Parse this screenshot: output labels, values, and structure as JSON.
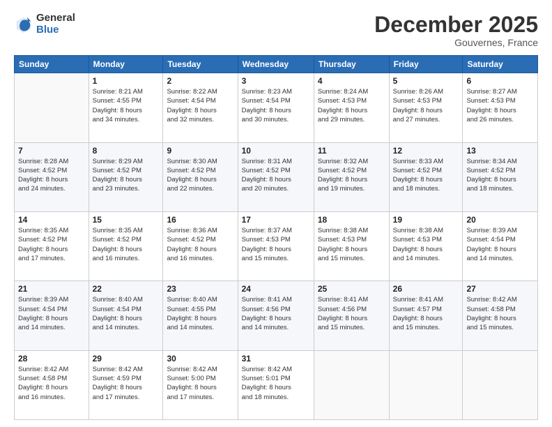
{
  "logo": {
    "general": "General",
    "blue": "Blue"
  },
  "header": {
    "month_year": "December 2025",
    "location": "Gouvernes, France"
  },
  "weekdays": [
    "Sunday",
    "Monday",
    "Tuesday",
    "Wednesday",
    "Thursday",
    "Friday",
    "Saturday"
  ],
  "weeks": [
    [
      {
        "day": "",
        "info": ""
      },
      {
        "day": "1",
        "info": "Sunrise: 8:21 AM\nSunset: 4:55 PM\nDaylight: 8 hours\nand 34 minutes."
      },
      {
        "day": "2",
        "info": "Sunrise: 8:22 AM\nSunset: 4:54 PM\nDaylight: 8 hours\nand 32 minutes."
      },
      {
        "day": "3",
        "info": "Sunrise: 8:23 AM\nSunset: 4:54 PM\nDaylight: 8 hours\nand 30 minutes."
      },
      {
        "day": "4",
        "info": "Sunrise: 8:24 AM\nSunset: 4:53 PM\nDaylight: 8 hours\nand 29 minutes."
      },
      {
        "day": "5",
        "info": "Sunrise: 8:26 AM\nSunset: 4:53 PM\nDaylight: 8 hours\nand 27 minutes."
      },
      {
        "day": "6",
        "info": "Sunrise: 8:27 AM\nSunset: 4:53 PM\nDaylight: 8 hours\nand 26 minutes."
      }
    ],
    [
      {
        "day": "7",
        "info": "Sunrise: 8:28 AM\nSunset: 4:52 PM\nDaylight: 8 hours\nand 24 minutes."
      },
      {
        "day": "8",
        "info": "Sunrise: 8:29 AM\nSunset: 4:52 PM\nDaylight: 8 hours\nand 23 minutes."
      },
      {
        "day": "9",
        "info": "Sunrise: 8:30 AM\nSunset: 4:52 PM\nDaylight: 8 hours\nand 22 minutes."
      },
      {
        "day": "10",
        "info": "Sunrise: 8:31 AM\nSunset: 4:52 PM\nDaylight: 8 hours\nand 20 minutes."
      },
      {
        "day": "11",
        "info": "Sunrise: 8:32 AM\nSunset: 4:52 PM\nDaylight: 8 hours\nand 19 minutes."
      },
      {
        "day": "12",
        "info": "Sunrise: 8:33 AM\nSunset: 4:52 PM\nDaylight: 8 hours\nand 18 minutes."
      },
      {
        "day": "13",
        "info": "Sunrise: 8:34 AM\nSunset: 4:52 PM\nDaylight: 8 hours\nand 18 minutes."
      }
    ],
    [
      {
        "day": "14",
        "info": "Sunrise: 8:35 AM\nSunset: 4:52 PM\nDaylight: 8 hours\nand 17 minutes."
      },
      {
        "day": "15",
        "info": "Sunrise: 8:35 AM\nSunset: 4:52 PM\nDaylight: 8 hours\nand 16 minutes."
      },
      {
        "day": "16",
        "info": "Sunrise: 8:36 AM\nSunset: 4:52 PM\nDaylight: 8 hours\nand 16 minutes."
      },
      {
        "day": "17",
        "info": "Sunrise: 8:37 AM\nSunset: 4:53 PM\nDaylight: 8 hours\nand 15 minutes."
      },
      {
        "day": "18",
        "info": "Sunrise: 8:38 AM\nSunset: 4:53 PM\nDaylight: 8 hours\nand 15 minutes."
      },
      {
        "day": "19",
        "info": "Sunrise: 8:38 AM\nSunset: 4:53 PM\nDaylight: 8 hours\nand 14 minutes."
      },
      {
        "day": "20",
        "info": "Sunrise: 8:39 AM\nSunset: 4:54 PM\nDaylight: 8 hours\nand 14 minutes."
      }
    ],
    [
      {
        "day": "21",
        "info": "Sunrise: 8:39 AM\nSunset: 4:54 PM\nDaylight: 8 hours\nand 14 minutes."
      },
      {
        "day": "22",
        "info": "Sunrise: 8:40 AM\nSunset: 4:54 PM\nDaylight: 8 hours\nand 14 minutes."
      },
      {
        "day": "23",
        "info": "Sunrise: 8:40 AM\nSunset: 4:55 PM\nDaylight: 8 hours\nand 14 minutes."
      },
      {
        "day": "24",
        "info": "Sunrise: 8:41 AM\nSunset: 4:56 PM\nDaylight: 8 hours\nand 14 minutes."
      },
      {
        "day": "25",
        "info": "Sunrise: 8:41 AM\nSunset: 4:56 PM\nDaylight: 8 hours\nand 15 minutes."
      },
      {
        "day": "26",
        "info": "Sunrise: 8:41 AM\nSunset: 4:57 PM\nDaylight: 8 hours\nand 15 minutes."
      },
      {
        "day": "27",
        "info": "Sunrise: 8:42 AM\nSunset: 4:58 PM\nDaylight: 8 hours\nand 15 minutes."
      }
    ],
    [
      {
        "day": "28",
        "info": "Sunrise: 8:42 AM\nSunset: 4:58 PM\nDaylight: 8 hours\nand 16 minutes."
      },
      {
        "day": "29",
        "info": "Sunrise: 8:42 AM\nSunset: 4:59 PM\nDaylight: 8 hours\nand 17 minutes."
      },
      {
        "day": "30",
        "info": "Sunrise: 8:42 AM\nSunset: 5:00 PM\nDaylight: 8 hours\nand 17 minutes."
      },
      {
        "day": "31",
        "info": "Sunrise: 8:42 AM\nSunset: 5:01 PM\nDaylight: 8 hours\nand 18 minutes."
      },
      {
        "day": "",
        "info": ""
      },
      {
        "day": "",
        "info": ""
      },
      {
        "day": "",
        "info": ""
      }
    ]
  ]
}
